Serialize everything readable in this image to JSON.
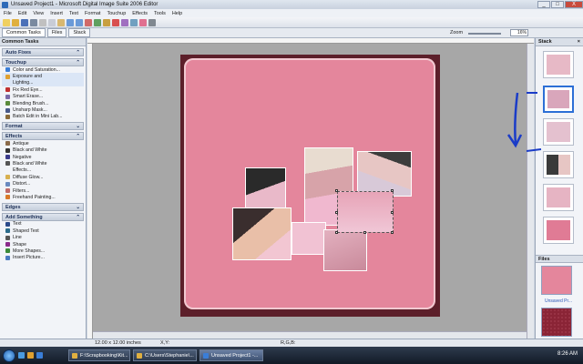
{
  "window": {
    "title": "Unsaved Project1 - Microsoft Digital Image Suite 2006 Editor",
    "buttons": [
      "_",
      "□",
      "X"
    ]
  },
  "menu": [
    "File",
    "Edit",
    "View",
    "Insert",
    "Text",
    "Format",
    "Touchup",
    "Effects",
    "Tools",
    "Help"
  ],
  "tabs": {
    "common_tasks": "Common Tasks",
    "files": "Files",
    "stack": "Stack"
  },
  "zoom": {
    "label": "Zoom",
    "value": "16%"
  },
  "left_panel": {
    "title": "Common Tasks",
    "sections": [
      {
        "header": "Auto Fixes",
        "items": []
      },
      {
        "header": "Touchup",
        "items": [
          {
            "label": "Color and Saturation...",
            "icon": "color-icon",
            "color": "#3a7ed8"
          },
          {
            "label": "Exposure and",
            "icon": "exposure-icon",
            "color": "#e0a030"
          },
          {
            "label": "Lighting...",
            "icon": "",
            "color": ""
          },
          {
            "label": "Fix Red Eye...",
            "icon": "eye-icon",
            "color": "#c03030"
          },
          {
            "label": "Smart Erase...",
            "icon": "eraser-icon",
            "color": "#7a6aa8"
          },
          {
            "label": "Blending Brush...",
            "icon": "brush-icon",
            "color": "#5a8a3a"
          },
          {
            "label": "Unsharp Mask...",
            "icon": "sharpen-icon",
            "color": "#4a5a8a"
          },
          {
            "label": "Batch Edit in Mini Lab...",
            "icon": "batch-icon",
            "color": "#8a6a3a"
          }
        ]
      },
      {
        "header": "Format",
        "items": []
      },
      {
        "header": "Effects",
        "items": [
          {
            "label": "Antique",
            "icon": "antique-icon",
            "color": "#8a6a4a"
          },
          {
            "label": "Black and White",
            "icon": "bw-icon",
            "color": "#333333"
          },
          {
            "label": "Negative",
            "icon": "negative-icon",
            "color": "#3a3a8a"
          },
          {
            "label": "Black and White",
            "icon": "bw-icon",
            "color": "#555555"
          },
          {
            "label": "Effects...",
            "icon": "",
            "color": ""
          },
          {
            "label": "Diffuse Glow...",
            "icon": "glow-icon",
            "color": "#d8b050"
          },
          {
            "label": "Distort...",
            "icon": "distort-icon",
            "color": "#6a8ac0"
          },
          {
            "label": "Filters...",
            "icon": "filters-icon",
            "color": "#c06a6a"
          },
          {
            "label": "Freehand Painting...",
            "icon": "paint-icon",
            "color": "#d87a2a"
          }
        ]
      },
      {
        "header": "Edges",
        "items": []
      },
      {
        "header": "Add Something",
        "items": [
          {
            "label": "Text",
            "icon": "text-icon",
            "color": "#2a4a8a"
          },
          {
            "label": "Shaped Text",
            "icon": "shaped-text-icon",
            "color": "#2a6a8a"
          },
          {
            "label": "Line",
            "icon": "line-icon",
            "color": "#555555"
          },
          {
            "label": "Shape",
            "icon": "shape-icon",
            "color": "#8a2a8a"
          },
          {
            "label": "More Shapes...",
            "icon": "shapes-icon",
            "color": "#3a8a3a"
          },
          {
            "label": "Insert Picture...",
            "icon": "picture-icon",
            "color": "#4a7ac0"
          }
        ]
      }
    ]
  },
  "right_panel": {
    "stack_title": "Stack",
    "files_title": "Files",
    "file_label": "Unsaved Pr...",
    "stack_colors": [
      "#e7b9c6",
      "#d9a6bb",
      "#e4c1cf",
      "#3a3a3a",
      "#e6b4c3",
      "#e07b95"
    ],
    "file_colors": [
      "#e4869c",
      "#8a2436"
    ]
  },
  "status": {
    "size": "12.00 x 12.00 inches",
    "xy": "X,Y:",
    "rgb": "R,G,B:"
  },
  "taskbar": {
    "items": [
      {
        "label": "F:\\Scrapbooking\\Kit...",
        "color": "#e0b040"
      },
      {
        "label": "C:\\Users\\Stephanie\\...",
        "color": "#e0b040"
      },
      {
        "label": "Unsaved Project1 -...",
        "color": "#3a7ed8"
      }
    ],
    "time": "8:26 AM"
  }
}
